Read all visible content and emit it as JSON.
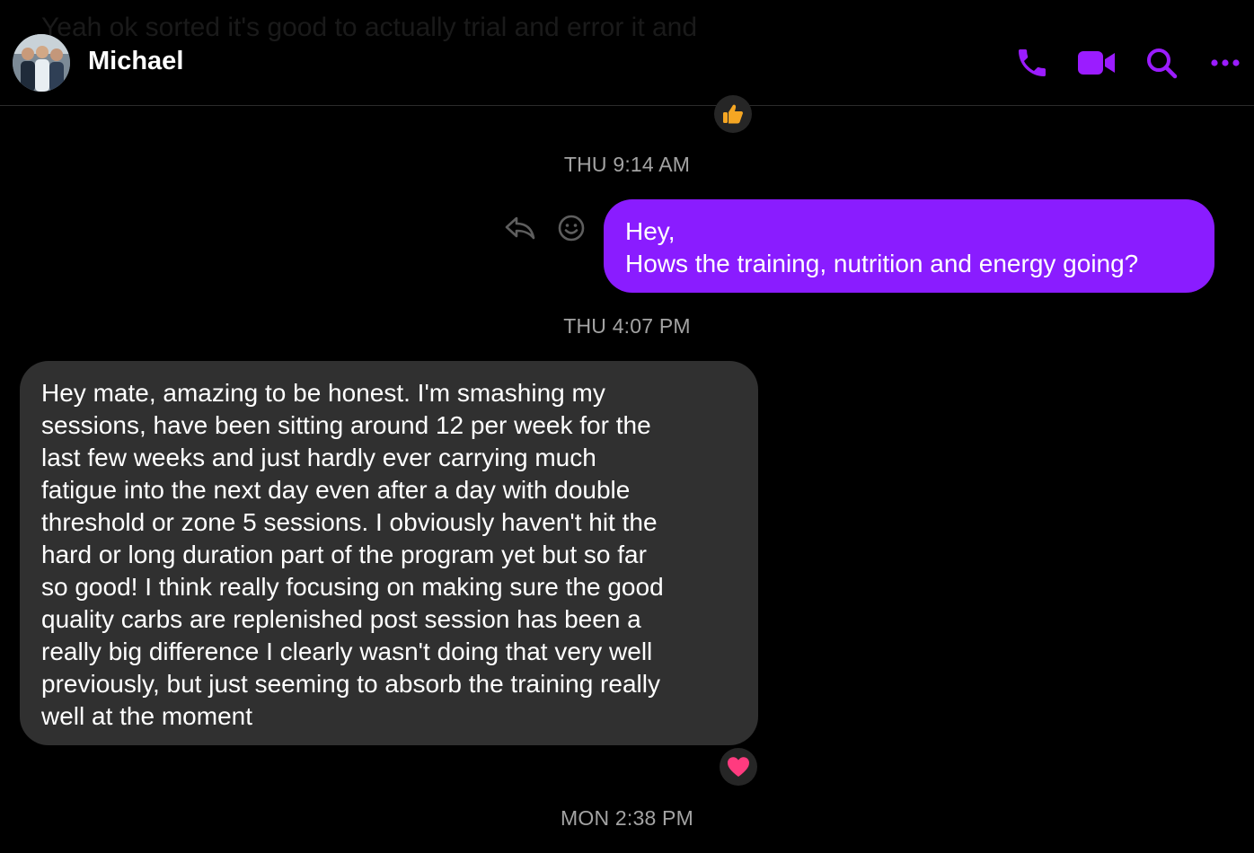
{
  "header": {
    "background_text": "Yeah ok sorted it's good to actually trial and error it and",
    "contact_name": "Michael  ",
    "icons": [
      "phone-icon",
      "video-camera-icon",
      "search-icon",
      "more-icon"
    ],
    "accent_color": "#8a1cff"
  },
  "thread": {
    "top_reaction": "thumbs-up",
    "timestamp_1": "THU 9:14 AM",
    "outgoing_message": "Hey,\nHows the training, nutrition and energy going?",
    "timestamp_2": "THU 4:07 PM",
    "incoming_message": "Hey mate, amazing to be honest. I'm smashing my\nsessions, have been sitting around 12 per week for the\nlast few weeks and just hardly ever carrying much\nfatigue into the next day even after a day with double\nthreshold or zone 5 sessions. I obviously haven't hit the\nhard or long duration part of the program yet but so far\nso good! I think really focusing on making sure the good\nquality carbs are replenished post session has been a\nreally big difference I clearly wasn't doing that very well\npreviously, but just seeming to absorb the training really\nwell at the moment",
    "incoming_reaction": "heart",
    "timestamp_3": "MON 2:38 PM"
  }
}
